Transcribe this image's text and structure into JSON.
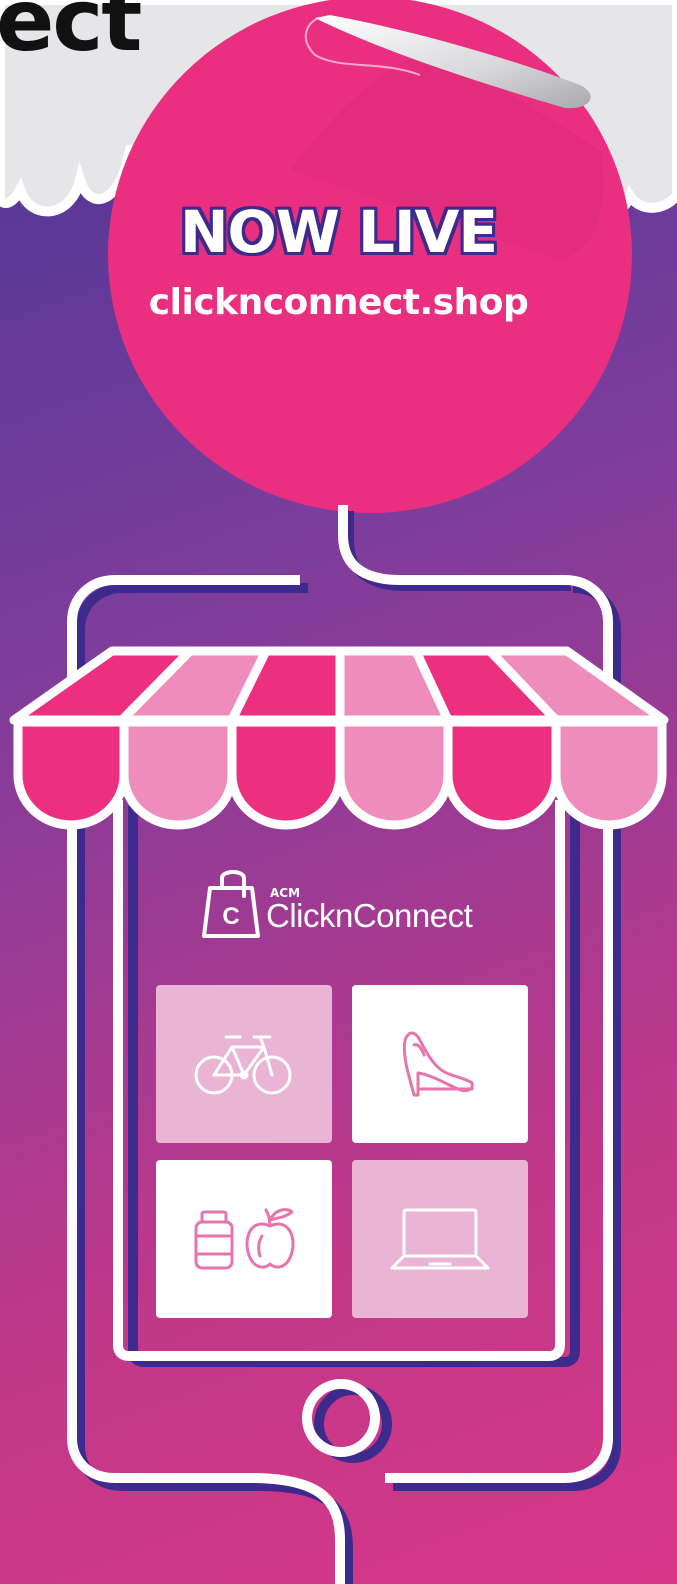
{
  "headline_fragment": "ect",
  "sticker": {
    "title": "NOW LIVE",
    "url": "clicknconnect.shop"
  },
  "brand": {
    "small": "ACM",
    "name": "ClicknConnect"
  },
  "tiles": [
    {
      "icon": "bicycle-icon",
      "style": "light"
    },
    {
      "icon": "high-heel-shoe-icon",
      "style": "white"
    },
    {
      "icon": "vitamins-and-apple-icon",
      "style": "white"
    },
    {
      "icon": "laptop-icon",
      "style": "light"
    }
  ],
  "colors": {
    "pink": "#ec2f7f",
    "light_pink": "#ee8cbb",
    "purple": "#3e2a8c",
    "tile_light": "#eab4d5"
  }
}
